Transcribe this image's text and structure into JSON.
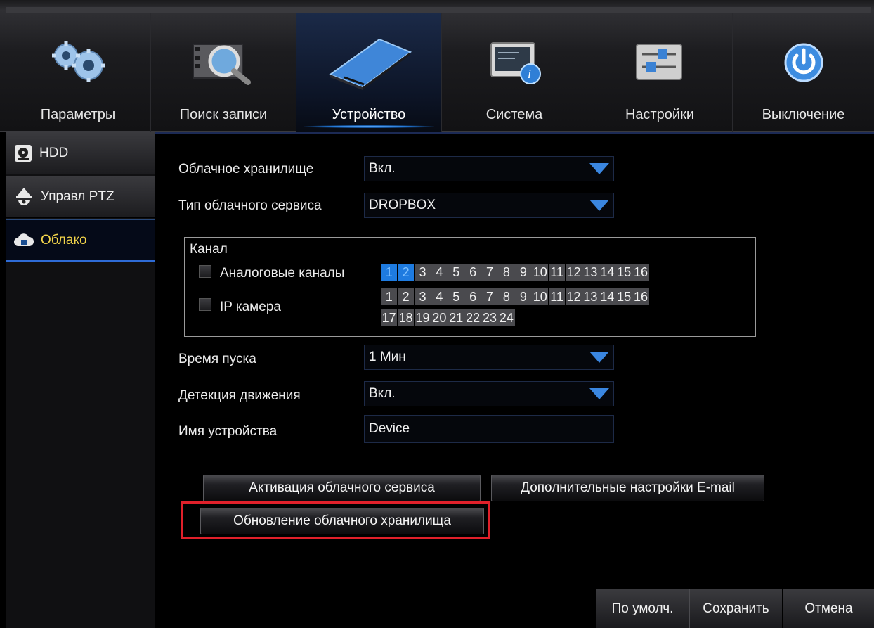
{
  "nav": {
    "items": [
      {
        "label": "Параметры",
        "icon": "gears-icon"
      },
      {
        "label": "Поиск записи",
        "icon": "film-search-icon"
      },
      {
        "label": "Устройство",
        "icon": "hard-drive-icon"
      },
      {
        "label": "Система",
        "icon": "system-info-icon"
      },
      {
        "label": "Настройки",
        "icon": "sliders-icon"
      },
      {
        "label": "Выключение",
        "icon": "power-icon"
      }
    ],
    "active_index": 2
  },
  "sidebar": {
    "items": [
      {
        "label": "HDD",
        "icon": "hdd-icon"
      },
      {
        "label": "Управл PTZ",
        "icon": "ptz-camera-icon"
      },
      {
        "label": "Облако",
        "icon": "cloud-icon"
      }
    ],
    "active_index": 2
  },
  "form": {
    "cloud_storage": {
      "label": "Облачное хранилище",
      "value": "Вкл."
    },
    "cloud_type": {
      "label": "Тип облачного сервиса",
      "value": "DROPBOX"
    },
    "channel": {
      "title": "Канал",
      "analog_label": "Аналоговые каналы",
      "analog_channels": [
        "1",
        "2",
        "3",
        "4",
        "5",
        "6",
        "7",
        "8",
        "9",
        "10",
        "11",
        "12",
        "13",
        "14",
        "15",
        "16"
      ],
      "analog_selected": [
        "1",
        "2"
      ],
      "ip_label": "IP камера",
      "ip_channels_row1": [
        "1",
        "2",
        "3",
        "4",
        "5",
        "6",
        "7",
        "8",
        "9",
        "10",
        "11",
        "12",
        "13",
        "14",
        "15",
        "16"
      ],
      "ip_channels_row2": [
        "17",
        "18",
        "19",
        "20",
        "21",
        "22",
        "23",
        "24"
      ]
    },
    "start_time": {
      "label": "Время пуска",
      "value": "1 Мин"
    },
    "motion_detection": {
      "label": "Детекция движения",
      "value": "Вкл."
    },
    "device_name": {
      "label": "Имя устройства",
      "value": "Device"
    }
  },
  "buttons": {
    "activate_cloud": "Активация облачного сервиса",
    "email_settings": "Дополнительные настройки E-mail",
    "update_cloud": "Обновление облачного хранилища",
    "default": "По умолч.",
    "save": "Сохранить",
    "cancel": "Отмена"
  },
  "colors": {
    "accent": "#1e7be0",
    "active_sidebar_text": "#f2d44a",
    "highlight_box": "#e0202a"
  }
}
